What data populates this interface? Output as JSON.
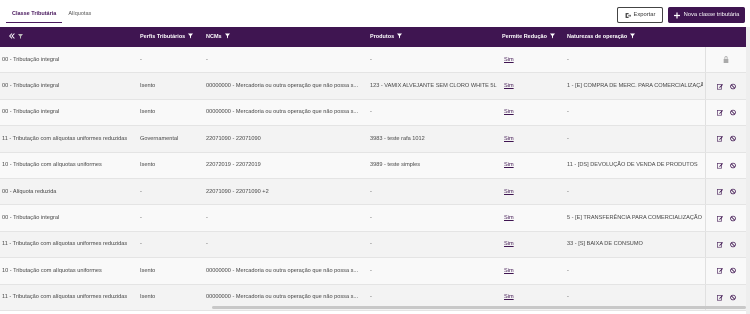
{
  "tabs": [
    {
      "label": "Classe Tributária",
      "active": true
    },
    {
      "label": "Alíquotas",
      "active": false
    }
  ],
  "toolbar": {
    "export_label": "Exportar",
    "new_label": "Nova classe tributária"
  },
  "columns": {
    "class": "",
    "profiles": "Perfis Tributários",
    "ncms": "NCMs",
    "products": "Produtos",
    "reduction": "Permite Redução",
    "operations": "Naturezas de operação"
  },
  "colors": {
    "brand": "#3f1551",
    "row_even": "#f3f3f3",
    "row_odd": "#f9f9f9"
  },
  "rows": [
    {
      "class": "00 - Tributação integral",
      "profiles": "-",
      "ncms": "-",
      "products": "-",
      "reduction": "Sim",
      "operations": "-",
      "locked": true
    },
    {
      "class": "00 - Tributação integral",
      "profiles": "Isento",
      "ncms": "00000000 - Mercadoria ou outra operação que não possa s...",
      "products": "123 - VAMIX ALVEJANTE SEM CLORO WHITE 5L",
      "reduction": "Sim",
      "operations": "1 - [E] COMPRA DE MERC. PARA COMERCIALIZAÇÃO",
      "locked": false
    },
    {
      "class": "00 - Tributação integral",
      "profiles": "Isento",
      "ncms": "00000000 - Mercadoria ou outra operação que não possa s...",
      "products": "-",
      "reduction": "Sim",
      "operations": "-",
      "locked": false
    },
    {
      "class": "11 - Tributação com alíquotas uniformes reduzidas",
      "profiles": "Governamental",
      "ncms": "22071090 - 22071090",
      "products": "3983 - teste rafa 1012",
      "reduction": "Sim",
      "operations": "-",
      "locked": false
    },
    {
      "class": "10 - Tributação com alíquotas uniformes",
      "profiles": "Isento",
      "ncms": "22072019 - 22072019",
      "products": "3989 - teste simples",
      "reduction": "Sim",
      "operations": "11 - [DS] DEVOLUÇÃO DE VENDA DE PRODUTOS",
      "locked": false
    },
    {
      "class": "00 - Alíquota reduzida",
      "profiles": "-",
      "ncms": "22071090 - 22071090 +2",
      "products": "-",
      "reduction": "Sim",
      "operations": "-",
      "locked": false
    },
    {
      "class": "00 - Tributação integral",
      "profiles": "-",
      "ncms": "-",
      "products": "-",
      "reduction": "Sim",
      "operations": "5 - [E] TRANSFERÊNCIA PARA COMERCIALIZAÇÃO",
      "locked": false
    },
    {
      "class": "11 - Tributação com alíquotas uniformes reduzidas",
      "profiles": "-",
      "ncms": "-",
      "products": "-",
      "reduction": "Sim",
      "operations": "33 - [S] BAIXA DE CONSUMO",
      "locked": false
    },
    {
      "class": "10 - Tributação com alíquotas uniformes",
      "profiles": "Isento",
      "ncms": "00000000 - Mercadoria ou outra operação que não possa s...",
      "products": "-",
      "reduction": "Sim",
      "operations": "-",
      "locked": false
    },
    {
      "class": "11 - Tributação com alíquotas uniformes reduzidas",
      "profiles": "Isento",
      "ncms": "00000000 - Mercadoria ou outra operação que não possa s...",
      "products": "-",
      "reduction": "Sim",
      "operations": "-",
      "locked": false
    }
  ]
}
